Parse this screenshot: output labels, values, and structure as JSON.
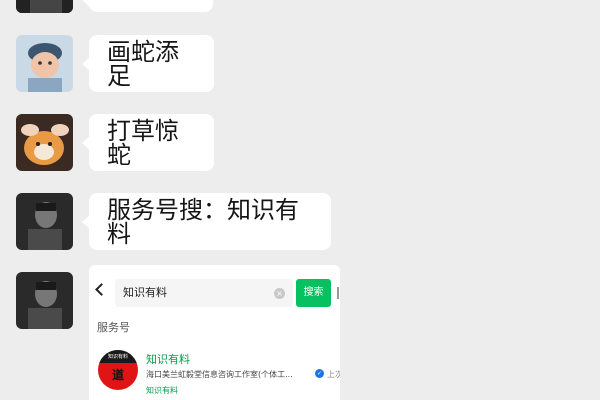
{
  "messages": [
    {
      "avatar": "dark-man-avatar",
      "text": ""
    },
    {
      "avatar": "baby-avatar",
      "text": "画蛇添足"
    },
    {
      "avatar": "cat-avatar",
      "text": "打草惊蛇"
    },
    {
      "avatar": "dark-man-avatar",
      "text": "服务号搜：知识有料"
    },
    {
      "avatar": "dark-man-avatar",
      "type": "screenshot"
    }
  ],
  "shot": {
    "search_text": "知识有料",
    "search_button": "搜索",
    "section_title": "服务号",
    "account": {
      "logo_text": "知识有料",
      "logo_char": "道",
      "name": "知识有料",
      "company": "海口美兰虹毅堂信息咨询工作室(个体工...",
      "extra": "上次",
      "sub": "知识有料"
    },
    "accent_color": "#07c160"
  }
}
